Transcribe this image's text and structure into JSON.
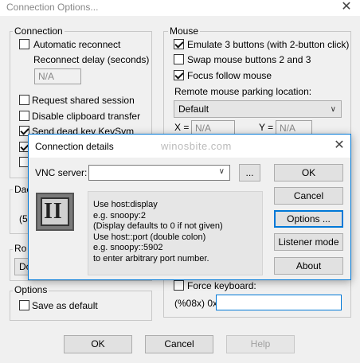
{
  "window": {
    "title": "Connection Options...",
    "close_glyph": "✕"
  },
  "connection": {
    "group_label": "Connection",
    "auto_reconnect": {
      "label": "Automatic reconnect",
      "checked": false
    },
    "reconnect_delay_label": "Reconnect delay (seconds)",
    "reconnect_delay_value": "N/A",
    "shared_session": {
      "label": "Request shared session",
      "checked": false
    },
    "disable_clipboard": {
      "label": "Disable clipboard transfer",
      "checked": false
    },
    "dead_key": {
      "label": "Send dead key KeySym",
      "checked": true
    }
  },
  "mouse": {
    "group_label": "Mouse",
    "emulate3": {
      "label": "Emulate 3 buttons (with 2-button click)",
      "checked": true
    },
    "swap_buttons": {
      "label": "Swap mouse buttons 2 and 3",
      "checked": false
    },
    "focus_follow": {
      "label": "Focus follow mouse",
      "checked": true
    },
    "parking_label": "Remote mouse parking location:",
    "parking_value": "Default",
    "x_label": "X =",
    "x_value": "N/A",
    "y_label": "Y =",
    "y_value": "N/A"
  },
  "bg_fragments": {
    "dac": "Dac",
    "five": "(5",
    "ro": "Ro",
    "do": "Do"
  },
  "options_group": {
    "group_label": "Options",
    "save_default": {
      "label": "Save as default",
      "checked": false
    }
  },
  "keyboard": {
    "force_keyboard": {
      "label": "Force keyboard:",
      "checked": false
    },
    "hex_prefix": "(%08x)  0x",
    "hex_value": ""
  },
  "footer": {
    "ok": "OK",
    "cancel": "Cancel",
    "help": "Help"
  },
  "dialog": {
    "title": "Connection details",
    "watermark": "winosbite.com",
    "close_glyph": "✕",
    "vnc_server_label": "VNC server:",
    "vnc_server_value": "",
    "browse_label": "...",
    "buttons": {
      "ok": "OK",
      "cancel": "Cancel",
      "options": "Options ...",
      "listener": "Listener mode",
      "about": "About"
    },
    "info_lines": [
      "Use host:display",
      "e.g. snoopy:2",
      "(Display defaults to 0 if not given)",
      "Use host::port (double colon)",
      "e.g. snoopy::5902",
      "to enter arbitrary port number."
    ],
    "logo_text": "II"
  }
}
